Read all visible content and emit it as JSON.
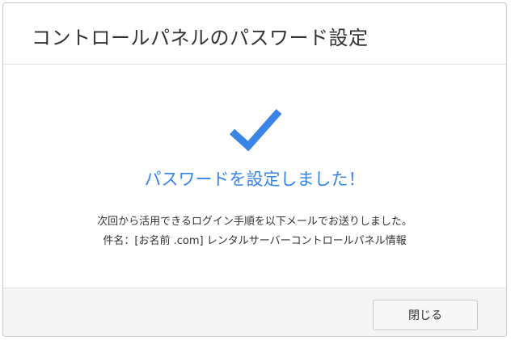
{
  "dialog": {
    "title": "コントロールパネルのパスワード設定",
    "success_icon": "check-icon",
    "success_message": "パスワードを設定しました！",
    "info_line1": "次回から活用できるログイン手順を以下メールでお送りしました。",
    "info_line2": "件名：[お名前 .com] レンタルサーバーコントロールパネル情報",
    "close_label": "閉じる"
  },
  "colors": {
    "accent": "#3a84e6",
    "title_text": "#333333",
    "footer_bg": "#f5f5f5"
  }
}
